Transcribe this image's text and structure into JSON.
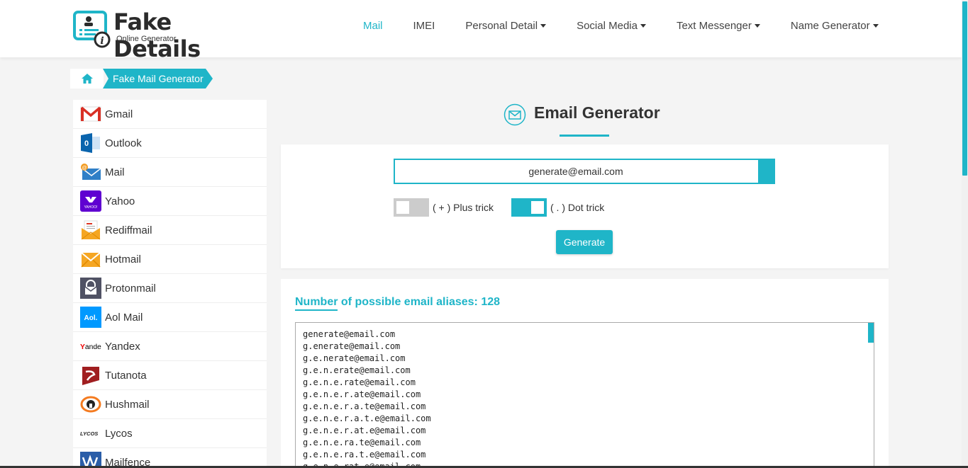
{
  "logo": {
    "title": "Fake Details",
    "subtitle": "Online Generator"
  },
  "nav": {
    "items": [
      {
        "label": "Mail",
        "dropdown": false,
        "active": true
      },
      {
        "label": "IMEI",
        "dropdown": false,
        "active": false
      },
      {
        "label": "Personal Detail",
        "dropdown": true,
        "active": false
      },
      {
        "label": "Social Media",
        "dropdown": true,
        "active": false
      },
      {
        "label": "Text Messenger",
        "dropdown": true,
        "active": false
      },
      {
        "label": "Name Generator",
        "dropdown": true,
        "active": false
      }
    ]
  },
  "breadcrumb": {
    "home_icon": "home-icon",
    "current": "Fake Mail Generator"
  },
  "sidebar": {
    "items": [
      {
        "label": "Gmail",
        "icon": "gmail-icon"
      },
      {
        "label": "Outlook",
        "icon": "outlook-icon"
      },
      {
        "label": "Mail",
        "icon": "mail-icon"
      },
      {
        "label": "Yahoo",
        "icon": "yahoo-icon"
      },
      {
        "label": "Rediffmail",
        "icon": "rediffmail-icon"
      },
      {
        "label": "Hotmail",
        "icon": "hotmail-icon"
      },
      {
        "label": "Protonmail",
        "icon": "protonmail-icon"
      },
      {
        "label": "Aol Mail",
        "icon": "aol-icon"
      },
      {
        "label": "Yandex",
        "icon": "yandex-icon"
      },
      {
        "label": "Tutanota",
        "icon": "tutanota-icon"
      },
      {
        "label": "Hushmail",
        "icon": "hushmail-icon"
      },
      {
        "label": "Lycos",
        "icon": "lycos-icon"
      },
      {
        "label": "Mailfence",
        "icon": "mailfence-icon"
      }
    ]
  },
  "main": {
    "title": "Email Generator",
    "email_value": "generate@email.com",
    "plus_trick": {
      "label": "( + ) Plus trick",
      "enabled": false
    },
    "dot_trick": {
      "label": "( . ) Dot trick",
      "enabled": true
    },
    "generate_label": "Generate",
    "aliases_title": "Number of possible email aliases: 128",
    "aliases": [
      "generate@email.com",
      "g.enerate@email.com",
      "g.e.nerate@email.com",
      "g.e.n.erate@email.com",
      "g.e.n.e.rate@email.com",
      "g.e.n.e.r.ate@email.com",
      "g.e.n.e.r.a.te@email.com",
      "g.e.n.e.r.a.t.e@email.com",
      "g.e.n.e.r.at.e@email.com",
      "g.e.n.e.ra.te@email.com",
      "g.e.n.e.ra.t.e@email.com",
      "g.e.n.e.rat.e@email.com"
    ]
  },
  "colors": {
    "accent": "#1fb5c8",
    "text": "#333333",
    "background": "#f4f4f4"
  }
}
